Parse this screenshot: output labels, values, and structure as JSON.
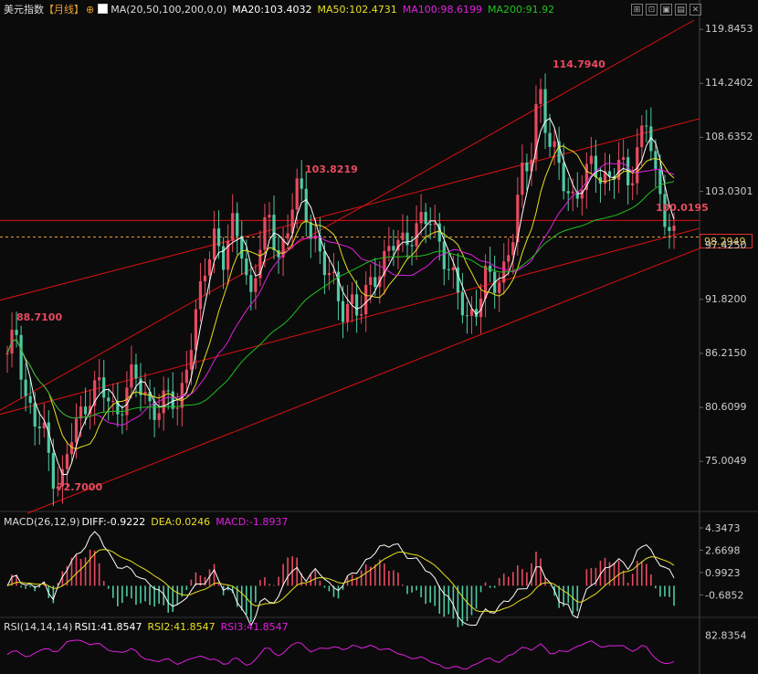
{
  "header": {
    "title": "美元指数",
    "period": "【月线】",
    "ma_label": "MA(20,50,100,200,0,0)",
    "ma20": "MA20:103.4032",
    "ma50": "MA50:102.4731",
    "ma100": "MA100:98.6199",
    "ma200": "MA200:91.92"
  },
  "macd_header": {
    "label": "MACD(26,12,9)",
    "diff": "DIFF:-0.9222",
    "dea": "DEA:0.0246",
    "macd": "MACD:-1.8937"
  },
  "rsi_header": {
    "label": "RSI(14,14,14)",
    "rsi1": "RSI1:41.8547",
    "rsi2": "RSI2:41.8547",
    "rsi3": "RSI3:41.8547"
  },
  "toolbar": {
    "icons": [
      "crosshair-icon",
      "zoom-icon",
      "expand-icon",
      "collapse-icon",
      "close-icon"
    ]
  },
  "colors": {
    "up": "#e84a5f",
    "down": "#4fc9a4",
    "ma20": "#ffffff",
    "ma50": "#e8e020",
    "ma100": "#e020e0",
    "ma200": "#20c020",
    "channel": "#e01010",
    "macd_diff": "#ffffff",
    "macd_dea": "#e8e020",
    "rsi": "#e020e0"
  },
  "chart_data": [
    {
      "type": "candlestick",
      "title": "美元指数",
      "y_ticks": [
        "119.8453",
        "114.2402",
        "108.6352",
        "103.0301",
        "97.4250",
        "91.8200",
        "86.2150",
        "80.6099",
        "75.0049"
      ],
      "ylim": [
        70.0,
        121.0
      ],
      "last_price": "98.2949",
      "annotations": [
        {
          "label": "114.7940",
          "value": 114.794
        },
        {
          "label": "103.8219",
          "value": 103.8219
        },
        {
          "label": "88.7100",
          "value": 88.71
        },
        {
          "label": "72.7000",
          "value": 72.7
        },
        {
          "label": "100.0195",
          "value": 100.0195
        }
      ],
      "horizontal_line": 100.0195,
      "dashed_line": 98.2949,
      "ohlc_anchor_closes": [
        85.5,
        88.7,
        82,
        79,
        78,
        74,
        72.7,
        77,
        79.5,
        82,
        83,
        81.5,
        80,
        82,
        84,
        82,
        81,
        80.5,
        81.5,
        80.6,
        86,
        90,
        95,
        99,
        96,
        99,
        97.5,
        92,
        97,
        100,
        97,
        98,
        103.8,
        101,
        99,
        95,
        94,
        91,
        92,
        89.5,
        93,
        95,
        96,
        97.5,
        98,
        99,
        99.5,
        100,
        98,
        95,
        92,
        90,
        91,
        94,
        93,
        95,
        98,
        104,
        106,
        114.8,
        108,
        106,
        104,
        102,
        104,
        106,
        105,
        104,
        106,
        104,
        108,
        110,
        104,
        101,
        98.3
      ],
      "ma_series_note": "MA20, MA50, MA100, MA200 overlay lines"
    },
    {
      "type": "bar",
      "title": "MACD(26,12,9)",
      "y_ticks": [
        "4.3473",
        "2.6698",
        "0.9923",
        "-0.6852"
      ],
      "series": [
        {
          "name": "DIFF",
          "last": -0.9222
        },
        {
          "name": "DEA",
          "last": 0.0246
        },
        {
          "name": "MACD",
          "last": -1.8937
        }
      ]
    },
    {
      "type": "line",
      "title": "RSI(14,14,14)",
      "y_ticks": [
        "82.8354"
      ],
      "series": [
        {
          "name": "RSI1",
          "last": 41.8547
        },
        {
          "name": "RSI2",
          "last": 41.8547
        },
        {
          "name": "RSI3",
          "last": 41.8547
        }
      ]
    }
  ]
}
